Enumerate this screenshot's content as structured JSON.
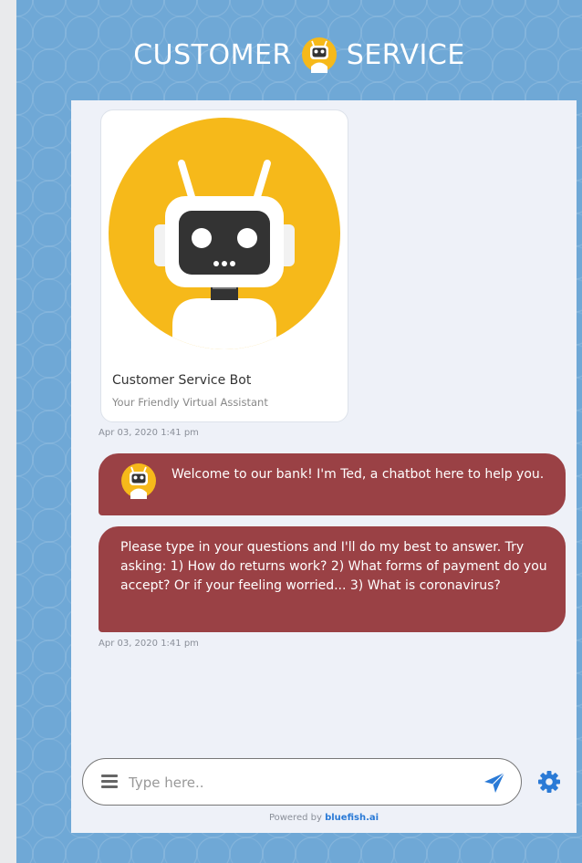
{
  "header": {
    "left_word": "CUSTOMER",
    "right_word": "SERVICE",
    "icon": "robot-icon"
  },
  "card": {
    "title": "Customer Service Bot",
    "subtitle": "Your Friendly Virtual Assistant",
    "image": "robot-avatar"
  },
  "timestamps": [
    "Apr 03, 2020 1:41 pm",
    "Apr 03, 2020 1:41 pm"
  ],
  "messages": [
    {
      "text": "Welcome to our bank! I'm Ted, a chatbot here to help you.",
      "avatar": "robot-icon"
    },
    {
      "text": "Please type in your questions and I'll do my best to answer. Try asking: 1) How do returns work? 2) What forms of payment do you accept? Or if your feeling worried... 3) What is coronavirus?"
    }
  ],
  "input": {
    "placeholder": "Type here.."
  },
  "footer": {
    "powered_prefix": "Powered by",
    "brand": "bluefish.ai"
  },
  "colors": {
    "background": "#6fa8d6",
    "panel": "#eef1f8",
    "bubble": "#9a4145",
    "accent": "#2a7ad6",
    "robot_yellow": "#f6b91a"
  }
}
